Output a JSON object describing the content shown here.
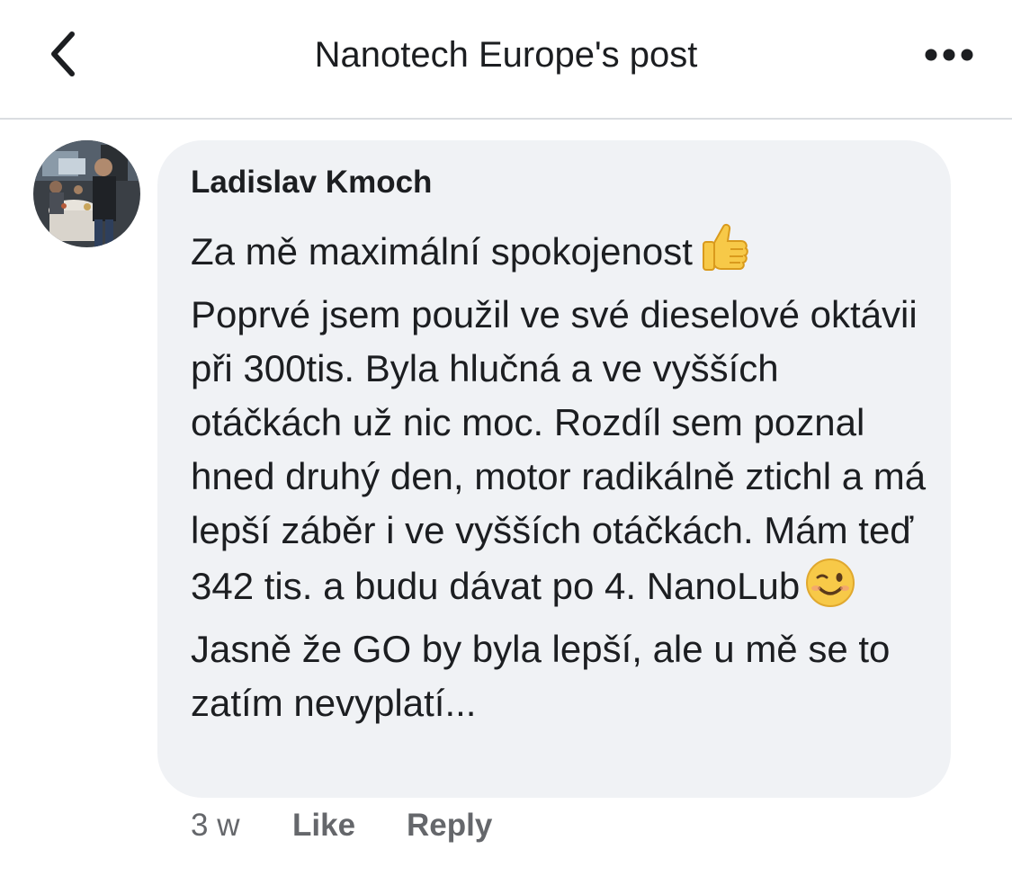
{
  "header": {
    "title": "Nanotech Europe's post",
    "back_icon": "chevron-left-icon",
    "more_icon": "ellipsis-icon"
  },
  "comment": {
    "author": "Ladislav Kmoch",
    "line1": "Za mě maximální spokojenost",
    "emoji1": "thumbs-up-emoji",
    "line2": "Poprvé jsem použil ve své dieselové oktávii při 300tis. Byla hlučná a ve vyšších otáčkách už nic moc. Rozdíl sem poznal hned druhý den, motor radikálně ztichl a má lepší záběr i ve vyšších otáčkách. Mám teď 342 tis. a budu dávat po 4. NanoLub",
    "emoji2": "winking-face-emoji",
    "line3": "Jasně že GO by byla lepší, ale u mě se to zatím nevyplatí...",
    "time": "3 w",
    "like_label": "Like",
    "reply_label": "Reply"
  },
  "colors": {
    "bubble": "#f0f2f5",
    "text": "#1c1e21",
    "meta": "#65676b",
    "divider": "#dadde1"
  }
}
